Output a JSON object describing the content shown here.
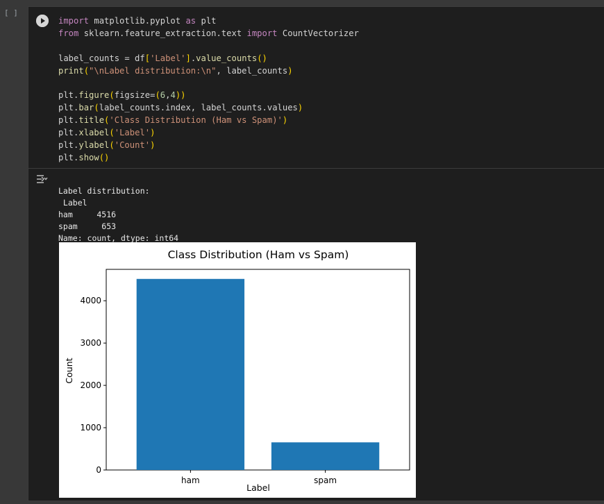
{
  "cell": {
    "bracket": "[ ]",
    "code_lines": [
      [
        [
          "kw",
          "import"
        ],
        [
          "t",
          " matplotlib.pyplot "
        ],
        [
          "kw",
          "as"
        ],
        [
          "t",
          " plt"
        ]
      ],
      [
        [
          "kw",
          "from"
        ],
        [
          "t",
          " sklearn.feature_extraction.text "
        ],
        [
          "kw",
          "import"
        ],
        [
          "t",
          " CountVectorizer"
        ]
      ],
      [],
      [
        [
          "t",
          "label_counts = df"
        ],
        [
          "par",
          "["
        ],
        [
          "str",
          "'Label'"
        ],
        [
          "par",
          "]"
        ],
        [
          "t",
          "."
        ],
        [
          "fn",
          "value_counts"
        ],
        [
          "par",
          "()"
        ]
      ],
      [
        [
          "fn",
          "print"
        ],
        [
          "par",
          "("
        ],
        [
          "str",
          "\"\\nLabel distribution:\\n\""
        ],
        [
          "t",
          ", label_counts"
        ],
        [
          "par",
          ")"
        ]
      ],
      [],
      [
        [
          "t",
          "plt."
        ],
        [
          "fn",
          "figure"
        ],
        [
          "par",
          "("
        ],
        [
          "t",
          "figsize="
        ],
        [
          "par",
          "("
        ],
        [
          "num",
          "6"
        ],
        [
          "t",
          ","
        ],
        [
          "num",
          "4"
        ],
        [
          "par",
          "))"
        ]
      ],
      [
        [
          "t",
          "plt."
        ],
        [
          "fn",
          "bar"
        ],
        [
          "par",
          "("
        ],
        [
          "t",
          "label_counts.index, label_counts.values"
        ],
        [
          "par",
          ")"
        ]
      ],
      [
        [
          "t",
          "plt."
        ],
        [
          "fn",
          "title"
        ],
        [
          "par",
          "("
        ],
        [
          "str",
          "'Class Distribution (Ham vs Spam)'"
        ],
        [
          "par",
          ")"
        ]
      ],
      [
        [
          "t",
          "plt."
        ],
        [
          "fn",
          "xlabel"
        ],
        [
          "par",
          "("
        ],
        [
          "str",
          "'Label'"
        ],
        [
          "par",
          ")"
        ]
      ],
      [
        [
          "t",
          "plt."
        ],
        [
          "fn",
          "ylabel"
        ],
        [
          "par",
          "("
        ],
        [
          "str",
          "'Count'"
        ],
        [
          "par",
          ")"
        ]
      ],
      [
        [
          "t",
          "plt."
        ],
        [
          "fn",
          "show"
        ],
        [
          "par",
          "()"
        ]
      ]
    ],
    "output_lines": [
      "Label distribution:",
      " Label",
      "ham     4516",
      "spam     653",
      "Name: count, dtype: int64"
    ]
  },
  "colors": {
    "bar": "#1f77b4"
  },
  "chart_data": {
    "type": "bar",
    "title": "Class Distribution (Ham vs Spam)",
    "xlabel": "Label",
    "ylabel": "Count",
    "categories": [
      "ham",
      "spam"
    ],
    "values": [
      4516,
      653
    ],
    "ylim": [
      0,
      4742
    ],
    "yticks": [
      0,
      1000,
      2000,
      3000,
      4000
    ],
    "grid": false
  }
}
